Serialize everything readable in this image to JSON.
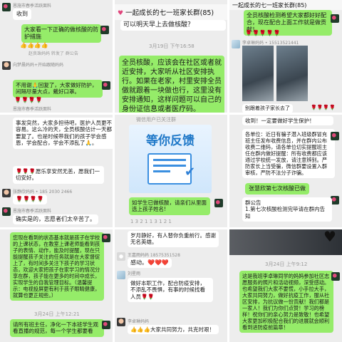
{
  "tiles": {
    "t1": {
      "top_meta": "恩施市春季活跃面料",
      "received": "收到",
      "g1": "大家看一下正确的做核酸的防护措施",
      "emoji_row": "👍👍👍👍",
      "group_notice_meta": "赵良珠妈妈 转发了 群公告",
      "mid_meta": "向梦晨妈妈+开始跟随妈妈",
      "g2": "不用谢🙏回复了，大家做好防护，间隔尽量大点，戴好口罩。",
      "roses": "🌹🌹🌹🌹",
      "bottom_meta": "恩施市春季活跃面料"
    },
    "t2": {
      "title_line": "一起成长的七一班家长群(85)",
      "subtitle": "可以明天早上去做核酸？",
      "date": "3月19日 下午16:58",
      "g1": "全员核酸，应该会在社区或者就近安排，大家听从社区安排执行。如果在老家，村里安排全员做就跟着一块做也行，这里没有安排通知，这样问题可以自己的身份证信息或者医疗码。"
    },
    "t3": {
      "top_title": "一起成长的七一班家长群(85)",
      "g1": "全员核酸检测希望大家都好好配合，现在配合上面工作就是做贡献！",
      "roses": "🌹🌹🌹🌹🌹",
      "meta": "李卓琳妈妈 • 15513521441",
      "note": "别跟着孩子家长去了",
      "roses2": "🌹🌹🌹🌹"
    },
    "t4": {
      "w1": "事发突然，大家多担待吧，医护人员更不容易。这么冷的天，全员核酸估计一天都要复了。也是时候带我们的孩子学会感恩，学会配合，学会不添乱了🙏。",
      "w2": "🌹🌹🌹愿乐享安然无恙，愿我们一切安好。",
      "meta1": "张静欣妈妈 • 185 2030 2466",
      "roses": "🌹🌹🌹🌹",
      "meta2": "恩施市春季活跃面料",
      "w3": "确实是的，志愿者们太辛苦了。"
    },
    "t5": {
      "top_note": "微信用户已关注群",
      "banner": "等你反馈",
      "w1": "如学生已做核酸，请亲们从里面选上孩子姓名!",
      "pills": "1 3 2 1 1 3 1 2 1"
    },
    "t6": {
      "w_top": "收到！一定要做好学生保护！",
      "w1": "各单位：近日有骗子潜入班级群冒充班主任发布收费信息，并在群内公布收费二维码，请各单位切实提醒班主任在群内做好提醒：所有收费都应该通过学校统一发放，请注意辨别。严防家长上当受骗，微信群要设置入群审核，严防不法分子诈骗。",
      "tag": "张慧欣第七次核酸已做",
      "w2": "群公告",
      "w3": "1.第七次核酸检测完毕请在群内告知"
    },
    "t7": {
      "w1": "您现在看到的状态基本就是孩子在学校的上课状态，在教室上课老师能看到孩子的表情、动作，能及时提醒，现在只能提醒孩子关注的任务就是在大家督促上了，有时间多关注下孩子的学习状态，欢迎大家把孩子在家学习的情况分享在群，孩子能在更多的时间中成长，实现学生的自我管理目标。（温馨提示：电视投屏更有利于孩子眼睛健康，就算也更正规些。）",
      "date": "3月24日 上午12:21",
      "g1": "请所有班主任，净化一下本班学生观看直播的规范，每一个学生都要看"
    },
    "t8": {
      "g1": "岁月静好，有人替你负重前行。感谢无名英雄。",
      "meta1": "王嘉雨妈妈 18575351528",
      "g2": "感动。",
      "hearts": "❤️❤️❤️",
      "meta2": "刘星雨",
      "g3": "做好本职工作，配合防疫安排，不添乱不畏惧，有事的时候找看人员🌹🌹",
      "meta3": "李卓琳妈妈",
      "g4": "👍👍👍大家共同努力，共克时艰！"
    },
    "t9": {
      "date": "3月24日 上午9:12",
      "w1": "这是我班李卓琳同学的妈妈参加社区志愿服务的照片和活动视频，深受感动。也希望我们大家不要慌，小手拉大手，大家共同努力，做好抗疫工作，服从社区安排，为抗议做一份贡献！我们都是一家人！我们为你们点赞！学习的榜样！祝你们的亲心努力是致敬！也希望大家更加积极配合我们的进展就会顺利看到进防疫前篇章！"
    }
  },
  "colors": {
    "chat_bg": "#ededed",
    "green_bubble": "#95ec69",
    "white_bubble": "#ffffff"
  }
}
